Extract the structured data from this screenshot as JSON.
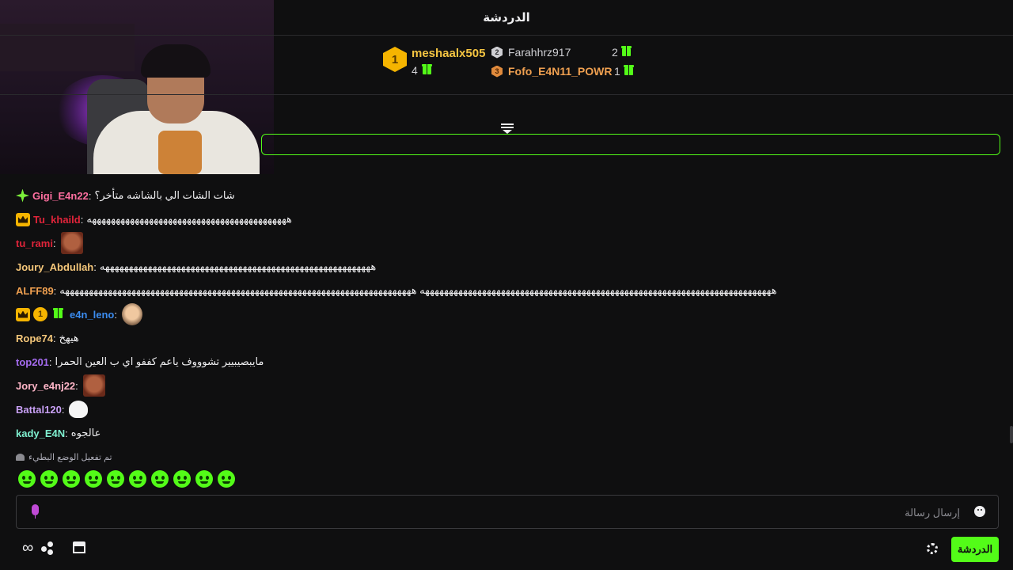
{
  "header": {
    "title": "الدردشة"
  },
  "leaderboard": {
    "first": {
      "rank": "1",
      "name": "meshaalx505",
      "count": "4"
    },
    "second": {
      "rank": "2",
      "name": "Farahhrz917",
      "count": "2"
    },
    "third": {
      "rank": "3",
      "name": "Fofo_E4N11_POWR",
      "count": "1"
    }
  },
  "messages": [
    {
      "user": "Gigi_E4n22",
      "color": "#ff6fa0",
      "text": "شات الشات الي بالشاشه متأخر؟",
      "badges": [
        "sparkle"
      ]
    },
    {
      "user": "Tu_khaild",
      "color": "#e0243a",
      "text": "ههههههههههههههههههههههههههههههههههههههههههه",
      "badges": [
        "crown"
      ]
    },
    {
      "user": "tu_rami",
      "color": "#e0243a",
      "text": "",
      "emote": "face1"
    },
    {
      "user": "Joury_Abdullah",
      "color": "#f5c77a",
      "text": "هههههههههههههههههههههههههههههههههههههههههههههههههههههههههه"
    },
    {
      "user": "ALFF89",
      "color": "#f0a050",
      "text": "ههههههههههههههههههههههههههههههههههههههههههههههههههههههههههههههههههههههههههه ههههههههههههههههههههههههههههههههههههههههههههههههههههههههههههههههههههههههههه"
    },
    {
      "user": "e4n_leno",
      "color": "#3b8cf0",
      "text": "",
      "badges": [
        "crown",
        "one",
        "gift"
      ],
      "emote": "face2"
    },
    {
      "user": "Rope74",
      "color": "#f5c77a",
      "text": "هيهخ"
    },
    {
      "user": "top201",
      "color": "#a56cf0",
      "text": "مايبصيبيير تشوووف ياعم كففو اي ب العين الحمرا"
    },
    {
      "user": "Jory_e4nj22",
      "color": "#ffb6c8",
      "text": "",
      "emote": "face1"
    },
    {
      "user": "Battal120",
      "color": "#c8a0f5",
      "text": "",
      "emote": "cloud"
    },
    {
      "user": "kady_E4N",
      "color": "#7ff0d0",
      "text": "عالجوه"
    }
  ],
  "slow_mode": {
    "text": "تم تفعيل الوضع البطيء"
  },
  "input": {
    "placeholder": "إرسال رسالة"
  },
  "bottom": {
    "chat_label": "الدردشة"
  },
  "colors": {
    "accent": "#53fc18",
    "background": "#0f0f10"
  }
}
